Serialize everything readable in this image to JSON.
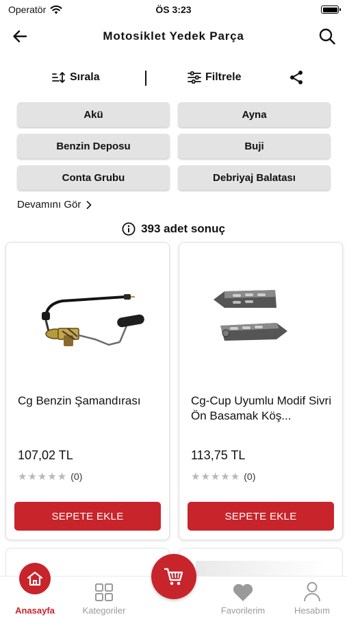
{
  "status_bar": {
    "carrier": "Operatör",
    "time": "ÖS 3:23",
    "battery_level": 1.0
  },
  "header": {
    "title": "Motosiklet Yedek Parça",
    "back_icon": "arrow-left-icon",
    "search_icon": "search-icon"
  },
  "toolbar": {
    "sort_label": "Sırala",
    "filter_label": "Filtrele",
    "share_icon": "share-icon"
  },
  "categories": [
    "Akü",
    "Ayna",
    "Benzin Deposu",
    "Buji",
    "Conta Grubu",
    "Debriyaj Balatası"
  ],
  "see_more": "Devamını Gör",
  "result_count": "393 adet sonuç",
  "products": [
    {
      "title": "Cg Benzin Şamandırası",
      "price": "107,02 TL",
      "rating_count": "(0)",
      "rating_value": 0,
      "button": "SEPETE EKLE"
    },
    {
      "title": "Cg-Cup Uyumlu Modif Sivri Ön Basamak Köş...",
      "price": "113,75 TL",
      "rating_count": "(0)",
      "rating_value": 0,
      "button": "SEPETE EKLE"
    }
  ],
  "tabs": [
    {
      "label": "Anasayfa",
      "icon": "home-icon",
      "active": true
    },
    {
      "label": "Kategoriler",
      "icon": "grid-icon",
      "active": false
    },
    {
      "label": "Favorilerim",
      "icon": "heart-icon",
      "active": false
    },
    {
      "label": "Hesabım",
      "icon": "user-icon",
      "active": false
    }
  ],
  "cart_icon": "cart-icon",
  "colors": {
    "accent": "#c8242b",
    "chip_bg": "#e3e3e3",
    "inactive_tab": "#9a9a9a"
  }
}
